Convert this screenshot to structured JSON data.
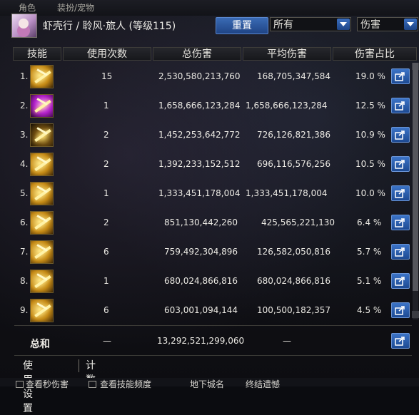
{
  "top_tabs": [
    "角色",
    "装扮/宠物"
  ],
  "header": {
    "character": "虾壳行 / 聆风·旅人 (等级115)",
    "reset_label": "重置",
    "filter_select": "所有",
    "mode_select": "伤害"
  },
  "columns": [
    "技能",
    "使用次数",
    "总伤害",
    "平均伤害",
    "伤害占比"
  ],
  "rows": [
    {
      "num": "1.",
      "uses": "15",
      "total": "2,530,580,213,760",
      "avg": "168,705,347,584",
      "pct": "19.0 %",
      "icon": "skill-icon-lightning-gold"
    },
    {
      "num": "2.",
      "uses": "1",
      "total": "1,658,666,123,284",
      "avg": "1,658,666,123,284",
      "pct": "12.5 %",
      "icon": "skill-icon-slash-purple"
    },
    {
      "num": "3.",
      "uses": "2",
      "total": "1,452,253,642,772",
      "avg": "726,126,821,386",
      "pct": "10.9 %",
      "icon": "skill-icon-slash-gold"
    },
    {
      "num": "4.",
      "uses": "2",
      "total": "1,392,233,152,512",
      "avg": "696,116,576,256",
      "pct": "10.5 %",
      "icon": "skill-icon-arrow-gold"
    },
    {
      "num": "5.",
      "uses": "1",
      "total": "1,333,451,178,004",
      "avg": "1,333,451,178,004",
      "pct": "10.0 %",
      "icon": "skill-icon-spear-gold"
    },
    {
      "num": "6.",
      "uses": "2",
      "total": "851,130,442,260",
      "avg": "425,565,221,130",
      "pct": "6.4 %",
      "icon": "skill-icon-gate-gold"
    },
    {
      "num": "7.",
      "uses": "6",
      "total": "759,492,304,896",
      "avg": "126,582,050,816",
      "pct": "5.7 %",
      "icon": "skill-icon-burst-gold"
    },
    {
      "num": "8.",
      "uses": "1",
      "total": "680,024,866,816",
      "avg": "680,024,866,816",
      "pct": "5.1 %",
      "icon": "skill-icon-flash-gold"
    },
    {
      "num": "9.",
      "uses": "6",
      "total": "603,001,094,144",
      "avg": "100,500,182,357",
      "pct": "4.5 %",
      "icon": "skill-icon-strike-gold"
    }
  ],
  "total": {
    "label": "总和",
    "uses": "—",
    "total": "13,292,521,299,060",
    "avg": "—"
  },
  "footer_tabs": [
    "使用设置",
    "计数"
  ],
  "bottom_options": [
    "查看秒伤害",
    "查看技能频度",
    "地下城名",
    "终结遗憾"
  ]
}
